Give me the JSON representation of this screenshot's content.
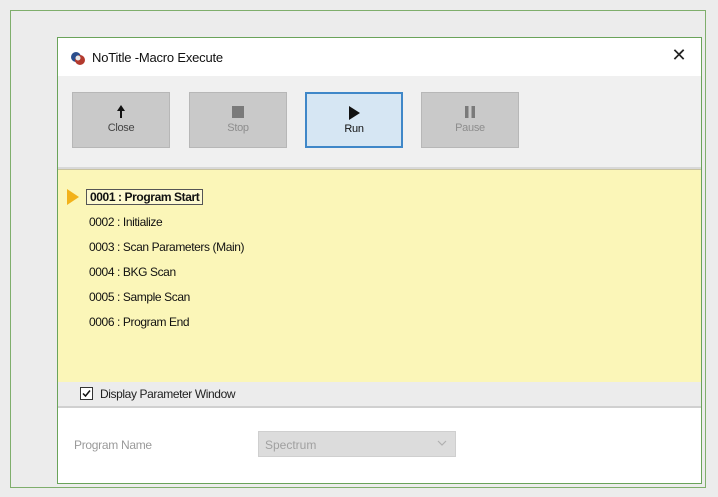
{
  "window": {
    "title": "NoTitle -Macro Execute",
    "close_glyph": "✕"
  },
  "toolbar": {
    "buttons": [
      {
        "label": "Close",
        "icon": "up-arrow-icon",
        "state": "enabled"
      },
      {
        "label": "Stop",
        "icon": "stop-square-icon",
        "state": "disabled"
      },
      {
        "label": "Run",
        "icon": "play-icon",
        "state": "active"
      },
      {
        "label": "Pause",
        "icon": "pause-icon",
        "state": "disabled"
      }
    ]
  },
  "steps": [
    {
      "text": "0001 : Program Start",
      "current": true
    },
    {
      "text": "0002 : Initialize"
    },
    {
      "text": "0003 : Scan Parameters (Main)"
    },
    {
      "text": "0004 : BKG Scan"
    },
    {
      "text": "0005 : Sample Scan"
    },
    {
      "text": "0006 : Program End"
    }
  ],
  "display_param": {
    "label": "Display Parameter Window",
    "checked": true
  },
  "params": {
    "program_name_label": "Program Name",
    "program_name_value": "Spectrum"
  },
  "colors": {
    "steps_bg": "#fbf6b8",
    "pointer": "#f2b21b",
    "run_border": "#3f87c8",
    "frame_green": "#6aa35a"
  }
}
